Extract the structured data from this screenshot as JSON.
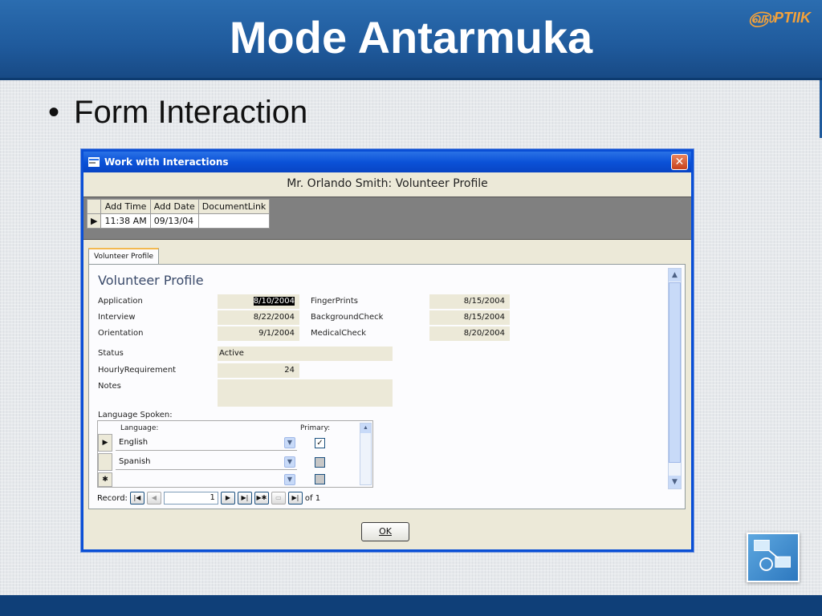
{
  "slide": {
    "title": "Mode Antarmuka",
    "logo_text": "PTIIK",
    "bullet_text": "Form Interaction"
  },
  "window": {
    "title": "Work with Interactions",
    "close_label": "✕",
    "heading": "Mr. Orlando Smith: Volunteer Profile",
    "mini_grid": {
      "columns": [
        "Add Time",
        "Add Date",
        "DocumentLink"
      ],
      "row": [
        "11:38 AM",
        "09/13/04",
        ""
      ]
    },
    "tab_label": "Volunteer Profile",
    "form_title": "Volunteer Profile",
    "fields_left": [
      {
        "label": "Application",
        "value": "8/10/2004"
      },
      {
        "label": "Interview",
        "value": "8/22/2004"
      },
      {
        "label": "Orientation",
        "value": "9/1/2004"
      }
    ],
    "fields_right": [
      {
        "label": "FingerPrints",
        "value": "8/15/2004"
      },
      {
        "label": "BackgroundCheck",
        "value": "8/15/2004"
      },
      {
        "label": "MedicalCheck",
        "value": "8/20/2004"
      }
    ],
    "status": {
      "label": "Status",
      "value": "Active"
    },
    "hourly": {
      "label": "HourlyRequirement",
      "value": "24"
    },
    "notes": {
      "label": "Notes",
      "value": ""
    },
    "languages": {
      "section_label": "Language Spoken:",
      "col_language": "Language:",
      "col_primary": "Primary:",
      "rows": [
        {
          "language": "English",
          "primary": true
        },
        {
          "language": "Spanish",
          "primary": false
        },
        {
          "language": "",
          "primary": false
        }
      ]
    },
    "record_nav": {
      "label": "Record:",
      "current": "1",
      "of_text": "of 1"
    },
    "ok_label": "OK"
  }
}
